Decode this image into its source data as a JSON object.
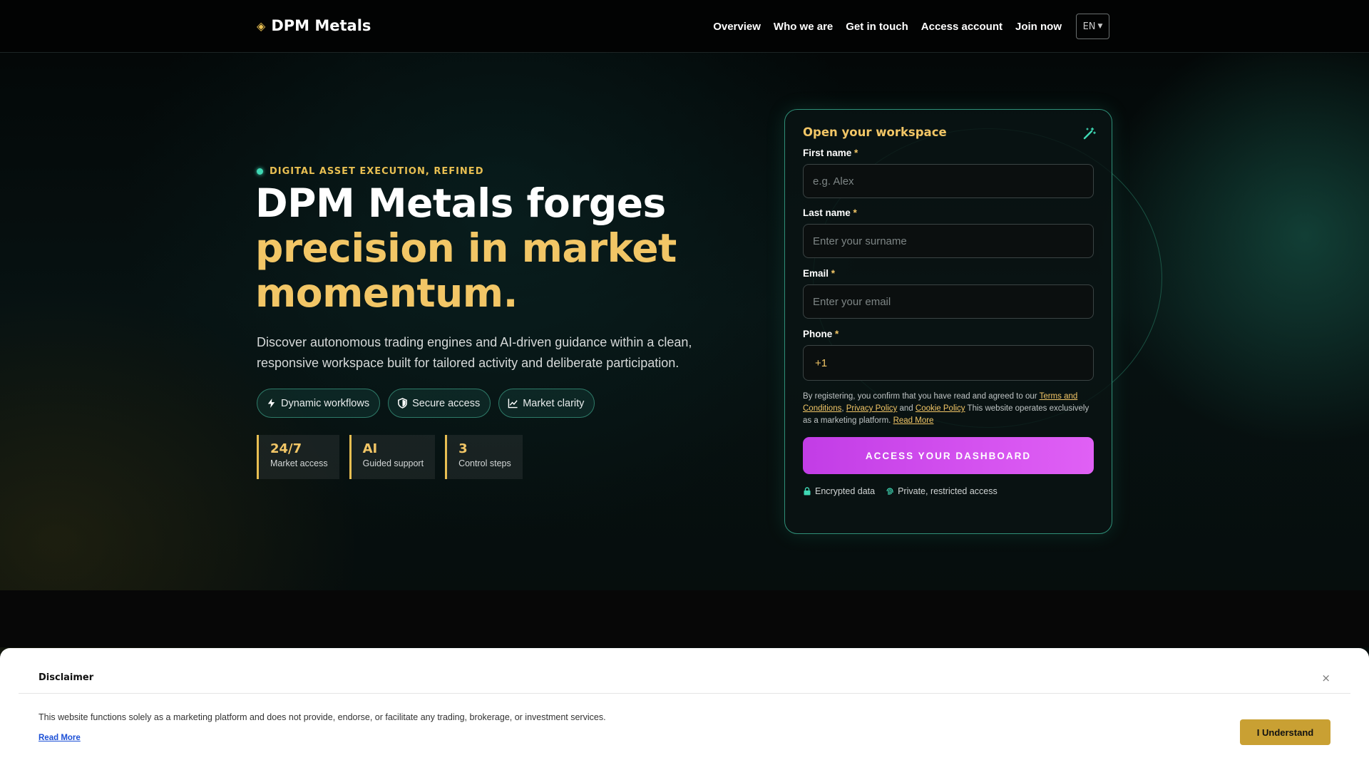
{
  "brand": {
    "name": "DPM Metals",
    "icon": "diamond-icon",
    "accent": "#e8bf52"
  },
  "nav": {
    "items": [
      "Overview",
      "Who we are",
      "Get in touch",
      "Access account",
      "Join now"
    ],
    "language": "EN"
  },
  "hero": {
    "eyebrow": "DIGITAL ASSET EXECUTION, REFINED",
    "headline_line1": "DPM Metals forges",
    "headline_line2": "precision in market",
    "headline_line3": "momentum.",
    "lead": "Discover autonomous trading engines and AI-driven guidance within a clean, responsive workspace built for tailored activity and deliberate participation.",
    "pills": [
      {
        "label": "Dynamic workflows",
        "icon": "bolt-icon"
      },
      {
        "label": "Secure access",
        "icon": "shield-icon"
      },
      {
        "label": "Market clarity",
        "icon": "chart-icon"
      }
    ],
    "stats": [
      {
        "value": "24/7",
        "label": "Market access"
      },
      {
        "value": "AI",
        "label": "Guided support"
      },
      {
        "value": "3",
        "label": "Control steps"
      }
    ]
  },
  "form": {
    "title": "Open your workspace",
    "icon": "magic-wand-icon",
    "first_name": {
      "label": "First name",
      "placeholder": "e.g. Alex"
    },
    "last_name": {
      "label": "Last name",
      "placeholder": "Enter your surname"
    },
    "email": {
      "label": "Email",
      "placeholder": "Enter your email"
    },
    "phone": {
      "label": "Phone",
      "prefix": "+1"
    },
    "required_mark": "*",
    "legal": {
      "pre": "By registering, you confirm that you have read and agreed to our ",
      "terms": "Terms and Conditions",
      "sep1": ", ",
      "privacy": "Privacy Policy",
      "sep2": " and ",
      "cookie": "Cookie Policy",
      "post": " This website operates exclusively as a marketing platform. ",
      "read_more": "Read More"
    },
    "submit": "ACCESS YOUR DASHBOARD",
    "submit_color": "#d34cef",
    "trust": [
      {
        "label": "Encrypted data",
        "icon": "lock-icon"
      },
      {
        "label": "Private, restricted access",
        "icon": "fingerprint-icon"
      }
    ]
  },
  "disclaimer": {
    "title": "Disclaimer",
    "text": "This website functions solely as a marketing platform and does not provide, endorse, or facilitate any trading, brokerage, or investment services.",
    "read_more": "Read More",
    "button": "I Understand",
    "close": "×"
  }
}
